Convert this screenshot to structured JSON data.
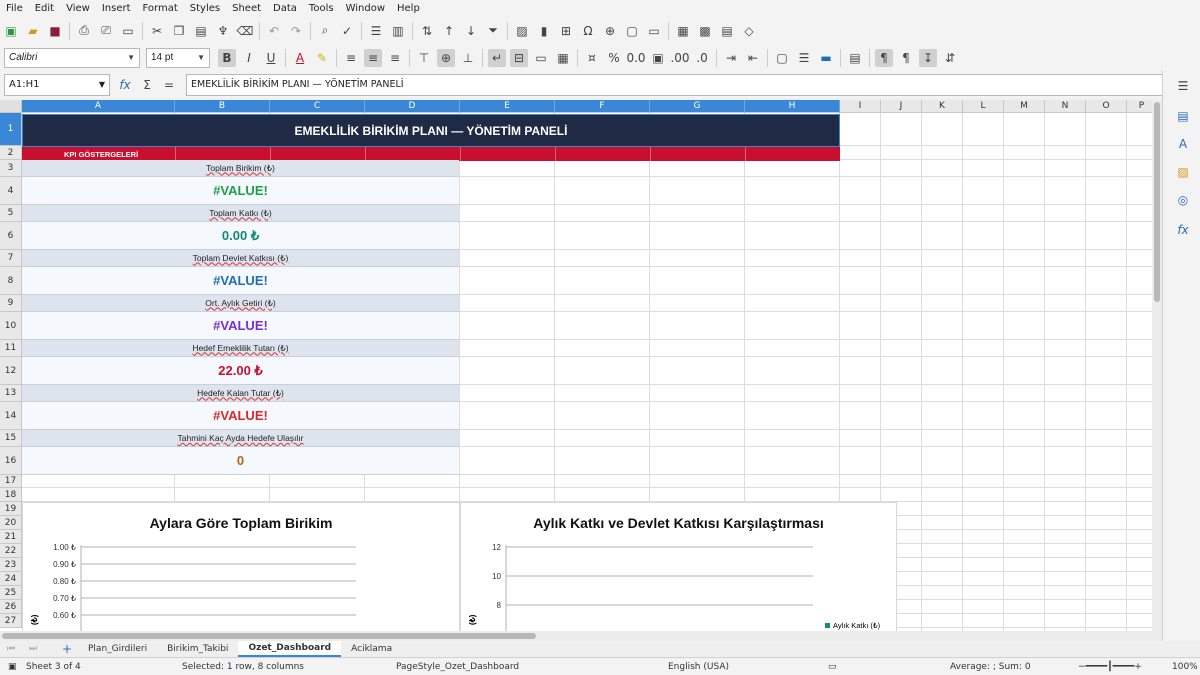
{
  "menu": [
    "File",
    "Edit",
    "View",
    "Insert",
    "Format",
    "Styles",
    "Sheet",
    "Data",
    "Tools",
    "Window",
    "Help"
  ],
  "font": {
    "name": "Calibri",
    "size": "14 pt"
  },
  "formula_bar": {
    "name_box": "A1:H1",
    "content": "EMEKLİLİK BİRİKİM PLANI — YÖNETİM PANELİ"
  },
  "columns": [
    "A",
    "B",
    "C",
    "D",
    "E",
    "F",
    "G",
    "H",
    "I",
    "J",
    "K",
    "L",
    "M",
    "N",
    "O",
    "P"
  ],
  "rows": [
    "1",
    "2",
    "3",
    "4",
    "5",
    "6",
    "7",
    "8",
    "9",
    "10",
    "11",
    "12",
    "13",
    "14",
    "15",
    "16",
    "17",
    "18",
    "19",
    "20",
    "21",
    "22",
    "23",
    "24",
    "25",
    "26",
    "27"
  ],
  "sheet": {
    "title": "EMEKLİLİK BİRİKİM PLANI — YÖNETİM PANELİ",
    "kpi_header": "KPI GÖSTERGELERİ",
    "kpis": [
      {
        "label": "Toplam Birikim (₺)",
        "value": "#VALUE!",
        "color": "#1e9e4a"
      },
      {
        "label": "Toplam Katkı (₺)",
        "value": "0.00 ₺",
        "color": "#138a7a"
      },
      {
        "label": "Toplam Devlet Katkısı (₺)",
        "value": "#VALUE!",
        "color": "#1f6fb5"
      },
      {
        "label": "Ort. Aylık Getiri (₺)",
        "value": "#VALUE!",
        "color": "#7a2fd6"
      },
      {
        "label": "Hedef Emeklilik Tutarı (₺)",
        "value": "22.00 ₺",
        "color": "#c8102e"
      },
      {
        "label": "Hedefe Kalan Tutar (₺)",
        "value": "#VALUE!",
        "color": "#d62b2b"
      },
      {
        "label": "Tahmini Kaç Ayda Hedefe Ulaşılır",
        "value": "0",
        "color": "#b5651d"
      }
    ]
  },
  "chart_data": [
    {
      "type": "line",
      "title": "Aylara Göre Toplam Birikim",
      "ylabel": "(₺)",
      "yticks": [
        "1.00 ₺",
        "0.90 ₺",
        "0.80 ₺",
        "0.70 ₺",
        "0.60 ₺"
      ],
      "ylim": [
        0.6,
        1.0
      ],
      "series": []
    },
    {
      "type": "bar",
      "title": "Aylık Katkı ve Devlet Katkısı Karşılaştırması",
      "ylabel": "(₺)",
      "yticks": [
        "12",
        "10",
        "8"
      ],
      "ylim": [
        8,
        12
      ],
      "legend": [
        "Aylık Katkı (₺)"
      ],
      "series": [
        {
          "name": "Aylık Katkı (₺)",
          "values": []
        }
      ]
    }
  ],
  "tabs": [
    "Plan_Girdileri",
    "Birikim_Takibi",
    "Ozet_Dashboard",
    "Aciklama"
  ],
  "active_tab": "Ozet_Dashboard",
  "status": {
    "sheet": "Sheet 3 of 4",
    "selection": "Selected: 1 row, 8 columns",
    "page_style": "PageStyle_Ozet_Dashboard",
    "language": "English (USA)",
    "sum": "Average: ; Sum: 0",
    "zoom": "100%"
  }
}
